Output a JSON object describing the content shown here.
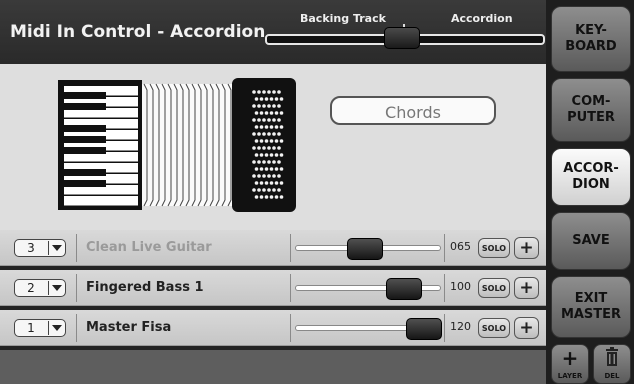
{
  "header": {
    "title": "Midi In Control - Accordion",
    "balance": {
      "left_label": "Backing Track",
      "right_label": "Accordion",
      "value": 0.5
    }
  },
  "main": {
    "mode_field": "Chords"
  },
  "layers": [
    {
      "channel": "3",
      "instrument": "Clean Live Guitar",
      "volume": 65,
      "volume_text": "065",
      "solo_label": "SOLO",
      "plus_label": "+",
      "muted": true
    },
    {
      "channel": "2",
      "instrument": "Fingered Bass 1",
      "volume": 100,
      "volume_text": "100",
      "solo_label": "SOLO",
      "plus_label": "+",
      "muted": false
    },
    {
      "channel": "1",
      "instrument": "Master Fisa",
      "volume": 120,
      "volume_text": "120",
      "solo_label": "SOLO",
      "plus_label": "+",
      "muted": false
    }
  ],
  "volume_max": 127,
  "right_panel": {
    "buttons": [
      {
        "label": "KEY-\nBOARD",
        "active": false
      },
      {
        "label": "COM-\nPUTER",
        "active": false
      },
      {
        "label": "ACCOR-\nDION",
        "active": true
      },
      {
        "label": "SAVE",
        "active": false
      },
      {
        "label": "EXIT\nMASTER",
        "active": false
      }
    ],
    "layer_btn": {
      "icon": "plus-icon",
      "label": "LAYER"
    },
    "del_btn": {
      "icon": "trash-icon",
      "label": "DEL"
    }
  },
  "colors": {
    "active_button": "#f0f0f0",
    "inactive_button": "#7a7a7a",
    "header_bg": "#2e2e2e",
    "main_bg": "#dedede"
  }
}
